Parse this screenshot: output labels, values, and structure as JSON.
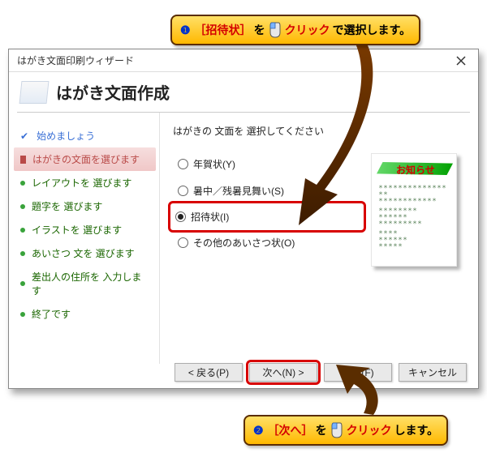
{
  "callout1": {
    "num": "❶",
    "hl_open": "［招待状］",
    "mid": "を",
    "act": "クリック",
    "tail": "で選択します。"
  },
  "callout2": {
    "num": "❷",
    "hl_open": "［次へ］",
    "mid": "を",
    "act": "クリック",
    "tail": "します。"
  },
  "dialog": {
    "title": "はがき文面印刷ウィザード",
    "header": "はがき文面作成"
  },
  "steps": {
    "s1": "始めましょう",
    "s2": "はがきの文面を選びます",
    "s3": "レイアウトを 選びます",
    "s4": "題字を 選びます",
    "s5": "イラストを 選びます",
    "s6": "あいさつ 文を 選びます",
    "s7": "差出人の住所を 入力します",
    "s8": "終了です"
  },
  "main": {
    "instruction": "はがきの 文面を 選択してください",
    "opt1": "年賀状(Y)",
    "opt2": "暑中／残暑見舞い(S)",
    "opt3": "招待状(I)",
    "opt4": "その他のあいさつ状(O)"
  },
  "preview": {
    "title": "お知らせ"
  },
  "buttons": {
    "back": "< 戻る(P)",
    "next": "次へ(N) >",
    "finish": "完了(F)",
    "cancel": "キャンセル"
  }
}
